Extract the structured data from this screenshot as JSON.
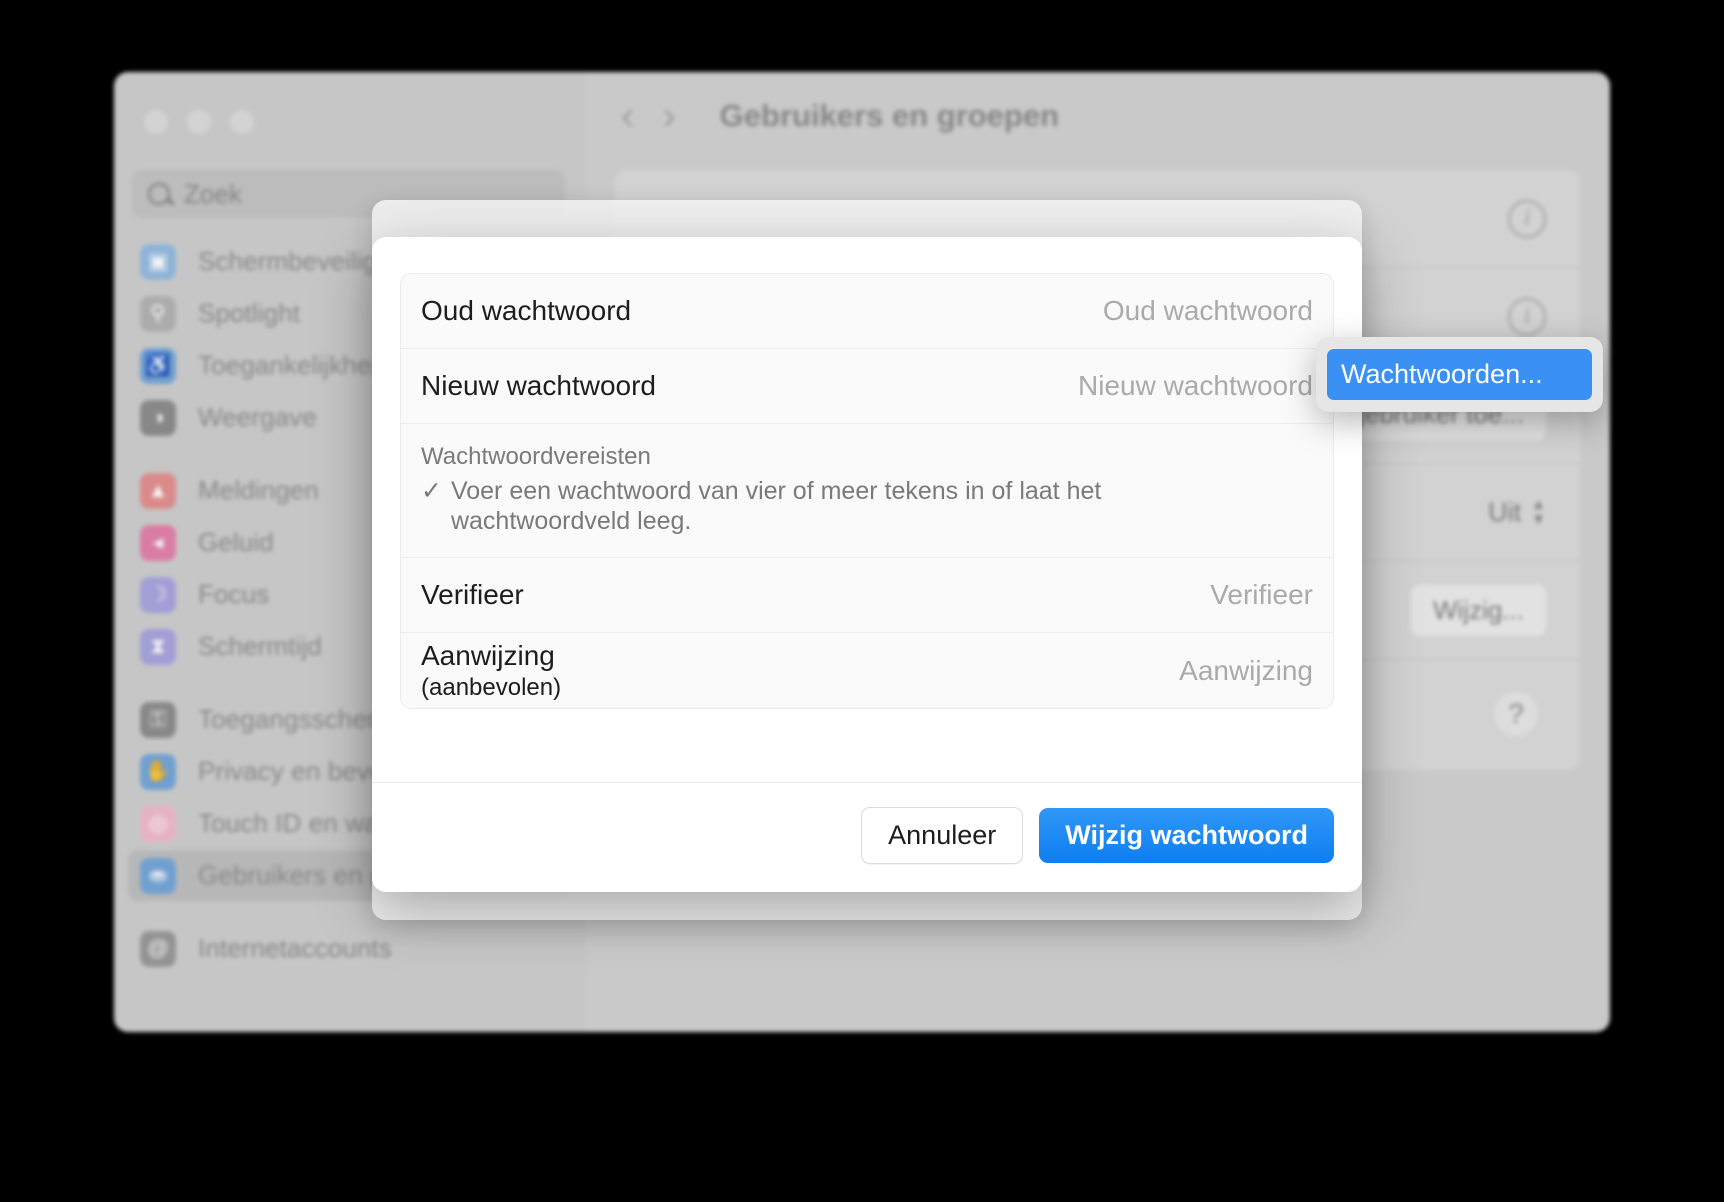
{
  "window": {
    "traffic_lights": [
      "close",
      "minimize",
      "zoom"
    ],
    "search": {
      "placeholder": "Zoek",
      "icon": "search-icon"
    },
    "sidebar_items": [
      {
        "label": "Schermbeveiliging",
        "icon": "screensaver-icon",
        "glyph": "▣",
        "color": "#8fbde8",
        "selected": false,
        "gap": false
      },
      {
        "label": "Spotlight",
        "icon": "spotlight-icon",
        "glyph": "⚲",
        "color": "#b4b4b4",
        "selected": false,
        "gap": false
      },
      {
        "label": "Toegankelijkheid",
        "icon": "accessibility-icon",
        "glyph": "♿",
        "color": "#6ea8e4",
        "selected": false,
        "gap": false
      },
      {
        "label": "Weergave",
        "icon": "display-icon",
        "glyph": "◑",
        "color": "#8e8e8e",
        "selected": false,
        "gap": false
      },
      {
        "label": "Meldingen",
        "icon": "notifications-icon",
        "glyph": "▲",
        "color": "#ef8d8d",
        "selected": false,
        "gap": true
      },
      {
        "label": "Geluid",
        "icon": "sound-icon",
        "glyph": "◂",
        "color": "#ef7fae",
        "selected": false,
        "gap": false
      },
      {
        "label": "Focus",
        "icon": "focus-icon",
        "glyph": "☽",
        "color": "#a9a4e8",
        "selected": false,
        "gap": false
      },
      {
        "label": "Schermtijd",
        "icon": "screentime-icon",
        "glyph": "⧗",
        "color": "#a9a4e8",
        "selected": false,
        "gap": false
      },
      {
        "label": "Toegangsscherm",
        "icon": "lock-screen-icon",
        "glyph": "⚿",
        "color": "#8e8e8e",
        "selected": false,
        "gap": true
      },
      {
        "label": "Privacy en beveiliging",
        "icon": "privacy-icon",
        "glyph": "✋",
        "color": "#6ea8e4",
        "selected": false,
        "gap": false
      },
      {
        "label": "Touch ID en wachtwoord",
        "icon": "touch-id-icon",
        "glyph": "◎",
        "color": "#f7b9cf",
        "selected": false,
        "gap": false
      },
      {
        "label": "Gebruikers en groepen",
        "icon": "users-groups-icon",
        "glyph": "⛂",
        "color": "#6ea8e4",
        "selected": true,
        "gap": false
      },
      {
        "label": "Internetaccounts",
        "icon": "internet-accounts-icon",
        "glyph": "@",
        "color": "#9a9a9a",
        "selected": false,
        "gap": true
      }
    ]
  },
  "content": {
    "back_icon": "chevron-left-icon",
    "forward_icon": "chevron-right-icon",
    "title": "Gebruikers en groepen",
    "rows": {
      "info_badge": "i",
      "add_user_label": "Voeg gebruiker toe...",
      "automatic_login_value": "Uit",
      "change_button": "Wijzig...",
      "help_label": "?"
    }
  },
  "sheet": {
    "fields": [
      {
        "label": "Oud wachtwoord",
        "placeholder": "Oud wachtwoord",
        "sub": ""
      },
      {
        "label": "Nieuw wachtwoord",
        "placeholder": "Nieuw wachtwoord",
        "sub": ""
      }
    ],
    "requirements": {
      "title": "Wachtwoordvereisten",
      "check_glyph": "✓",
      "text": "Voer een wachtwoord van vier of meer tekens in of laat het wachtwoordveld leeg."
    },
    "verify": {
      "label": "Verifieer",
      "placeholder": "Verifieer"
    },
    "hint": {
      "label": "Aanwijzing",
      "sub": "(aanbevolen)",
      "placeholder": "Aanwijzing"
    },
    "buttons": {
      "cancel": "Annuleer",
      "confirm": "Wijzig wachtwoord"
    }
  },
  "popover": {
    "item_label": "Wachtwoorden..."
  },
  "colors": {
    "accent": "#1e8bf5",
    "popover_highlight": "#3b90f4",
    "sheet_background": "#ffffff",
    "window_background": "#d2d2d2"
  }
}
